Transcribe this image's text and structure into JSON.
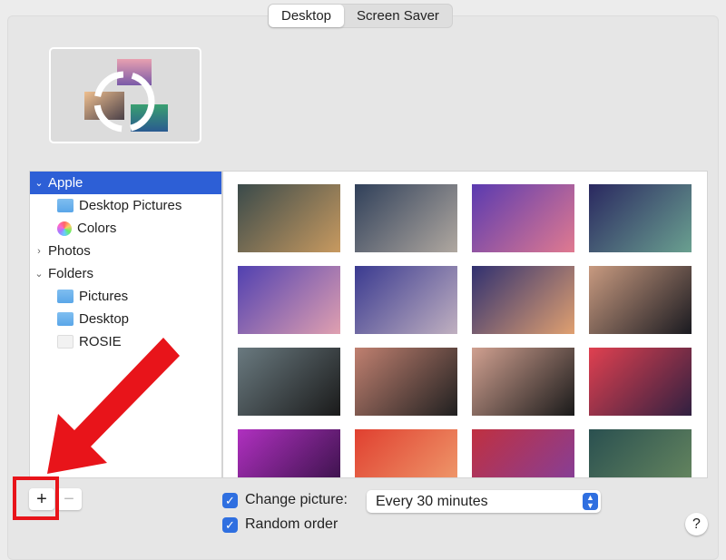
{
  "tabs": [
    {
      "label": "Desktop",
      "selected": true
    },
    {
      "label": "Screen Saver",
      "selected": false
    }
  ],
  "sidebar": {
    "items": [
      {
        "label": "Apple",
        "type": "group",
        "expanded": true,
        "selected": true
      },
      {
        "label": "Desktop Pictures",
        "icon": "folder-icon"
      },
      {
        "label": "Colors",
        "icon": "colors-icon"
      },
      {
        "label": "Photos",
        "type": "group",
        "expanded": false
      },
      {
        "label": "Folders",
        "type": "group",
        "expanded": true
      },
      {
        "label": "Pictures",
        "icon": "folder-icon"
      },
      {
        "label": "Desktop",
        "icon": "folder-icon"
      },
      {
        "label": "ROSIE",
        "icon": "blank-icon"
      }
    ]
  },
  "thumbnails": [
    [
      "#3a4a4a",
      "#c89a60"
    ],
    [
      "#30405a",
      "#b0a8a0"
    ],
    [
      "#5a3ab0",
      "#e07a90"
    ],
    [
      "#2a2860",
      "#6aa090"
    ],
    [
      "#5040b0",
      "#e0a0b0"
    ],
    [
      "#3a3a90",
      "#c0b0c0"
    ],
    [
      "#303070",
      "#e0a070"
    ],
    [
      "#c89a80",
      "#1a1a20"
    ],
    [
      "#6a7a80",
      "#1a1a1a"
    ],
    [
      "#c08070",
      "#202020"
    ],
    [
      "#d0a090",
      "#1a1a1a"
    ],
    [
      "#e04050",
      "#302040"
    ],
    [
      "#b030c0",
      "#301040"
    ],
    [
      "#e04030",
      "#f0a070"
    ],
    [
      "#c03040",
      "#8040a0"
    ],
    [
      "#2a5050",
      "#6a8a60"
    ]
  ],
  "controls": {
    "add_label": "+",
    "remove_label": "−",
    "change_picture_label": "Change picture:",
    "change_picture_checked": true,
    "interval": "Every 30 minutes",
    "random_order_label": "Random order",
    "random_order_checked": true,
    "help_label": "?"
  },
  "colors": {
    "accent": "#2d5fd6",
    "annotation": "#e8141a"
  }
}
